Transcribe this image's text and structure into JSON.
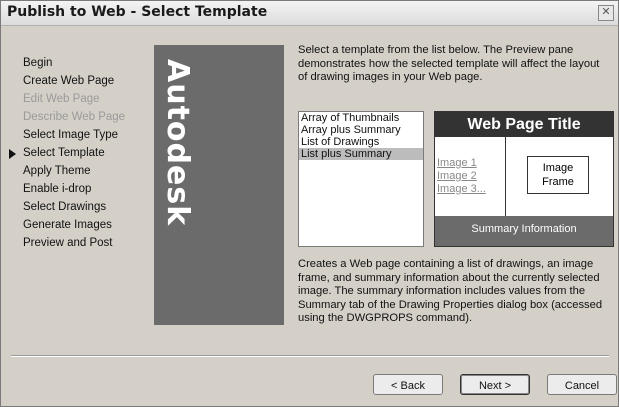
{
  "window": {
    "title": "Publish to Web - Select Template"
  },
  "nav": {
    "items": [
      {
        "label": "Begin",
        "disabled": false,
        "current": false
      },
      {
        "label": "Create Web Page",
        "disabled": false,
        "current": false
      },
      {
        "label": "Edit Web Page",
        "disabled": true,
        "current": false
      },
      {
        "label": "Describe Web Page",
        "disabled": true,
        "current": false
      },
      {
        "label": "Select Image Type",
        "disabled": false,
        "current": false
      },
      {
        "label": "Select Template",
        "disabled": false,
        "current": true
      },
      {
        "label": "Apply Theme",
        "disabled": false,
        "current": false
      },
      {
        "label": "Enable i-drop",
        "disabled": false,
        "current": false
      },
      {
        "label": "Select Drawings",
        "disabled": false,
        "current": false
      },
      {
        "label": "Generate Images",
        "disabled": false,
        "current": false
      },
      {
        "label": "Preview and Post",
        "disabled": false,
        "current": false
      }
    ]
  },
  "logo": {
    "text": "Autodesk"
  },
  "description": "Select a template from the list below.  The Preview pane demonstrates how the selected template will affect the layout of drawing images in your Web page.",
  "templates": {
    "items": [
      "Array of Thumbnails",
      "Array plus Summary",
      "List of Drawings",
      "List plus Summary"
    ],
    "selected_index": 3
  },
  "preview": {
    "title": "Web Page Title",
    "links": [
      "Image 1",
      "Image 2",
      "Image 3..."
    ],
    "frame_line1": "Image",
    "frame_line2": "Frame",
    "summary": "Summary Information"
  },
  "detail": "Creates a Web page containing a list of drawings, an image frame, and summary information about the currently selected image.  The summary information includes values from the Summary tab of the Drawing Properties dialog box (accessed using the DWGPROPS command).",
  "buttons": {
    "back": "< Back",
    "next": "Next >",
    "cancel": "Cancel"
  },
  "colors": {
    "logo_bg": "#6b6b6b",
    "preview_title_bg": "#333333",
    "selection_bg": "#bcbcbc"
  },
  "icons": {
    "close": "close-icon",
    "current_step": "arrow-right-icon"
  }
}
